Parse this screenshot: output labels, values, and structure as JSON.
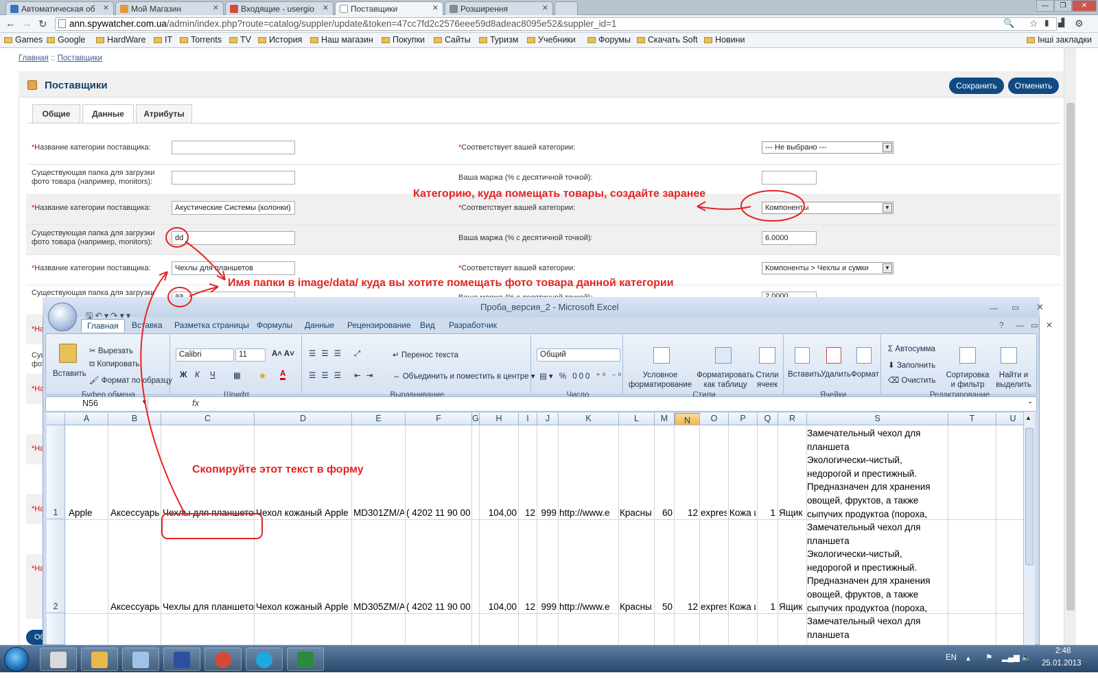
{
  "browser": {
    "tabs": [
      {
        "label": "Автоматическая об",
        "color": "#3b74c4"
      },
      {
        "label": "Мой Магазин",
        "color": "#e09a3a"
      },
      {
        "label": "Входящие - usergio",
        "color": "#d84a3a"
      },
      {
        "label": "Поставщики",
        "color": "#ffffff"
      },
      {
        "label": "Розширення",
        "color": "#8a8a8a"
      }
    ],
    "url_domain": "ann.spywatcher.com.ua",
    "url_path": "/admin/index.php?route=catalog/suppler/update&token=47cc7fd2c2576eee59d8adeac8095e52&suppler_id=1",
    "bookmarks": [
      "Games",
      "Google",
      "HardWare",
      "IT",
      "Torrents",
      "TV",
      "История",
      "Наш магазин",
      "Покупки",
      "Сайты",
      "Туризм",
      "Учебники",
      "Форумы",
      "Скачать Soft",
      "Новини"
    ],
    "other_bookmarks": "Інші закладки"
  },
  "page": {
    "breadcrumb_home": "Главная",
    "breadcrumb_sep": "::",
    "breadcrumb_current": "Поставщики",
    "title": "Поставщики",
    "save_label": "Сохранить",
    "cancel_label": "Отменить",
    "tabs": [
      "Общие",
      "Данные",
      "Атрибуты"
    ],
    "required_mark": "*",
    "rows": [
      {
        "label": "Название категории поставщика:",
        "value": "",
        "right_label": "Соответствует вашей категории:",
        "right_value": "--- Не выбрано ---",
        "required": true
      },
      {
        "label": "Существующая папка для загрузки фото товара (например, monitors):",
        "value": "",
        "right_label": "Ваша маржа (% с десятичной точкой):",
        "right_value": ""
      },
      {
        "label": "Название категории поставщика:",
        "value": "Акустические Системы (колонки)",
        "right_label": "Соответствует вашей категории:",
        "right_value": "Компоненты",
        "required": true
      },
      {
        "label": "Существующая папка для загрузки фото товара (например, monitors):",
        "value": "dd",
        "right_label": "Ваша маржа (% с десятичной точкой):",
        "right_value": "6.0000"
      },
      {
        "label": "Название категории поставщика:",
        "value": "Чехлы для планшетов",
        "right_label": "Соответствует вашей категории:",
        "right_value": "Компоненты > Чехлы и сумки",
        "required": true
      },
      {
        "label": "Существующая папка для загрузки фото товара (например, monitors):",
        "value": "aa",
        "right_label": "Ваша маржа (% с десятичной точкой):",
        "right_value": "2.0000"
      }
    ],
    "hidden_label_fragments": [
      "*На",
      "Сущ",
      "фот",
      "Об"
    ]
  },
  "annotations": {
    "category_note": "Категорию, куда помещать товары, создайте заранее",
    "folder_note": "Имя папки в image/data/ куда вы хотите помещать фото товара данной категории",
    "copy_note": "Скопируйте этот текст в форму",
    "color": "#e32424"
  },
  "excel": {
    "title": "Проба_версия_2 - Microsoft Excel",
    "ribbon_tabs": [
      "Главная",
      "Вставка",
      "Разметка страницы",
      "Формулы",
      "Данные",
      "Рецензирование",
      "Вид",
      "Разработчик"
    ],
    "clipboard": {
      "paste": "Вставить",
      "cut": "Вырезать",
      "copy": "Копировать",
      "format_painter": "Формат по образцу",
      "group": "Буфер обмена"
    },
    "font": {
      "name": "Calibri",
      "size": "11",
      "group": "Шрифт"
    },
    "alignment": {
      "wrap": "Перенос текста",
      "merge": "Объединить и поместить в центре",
      "group": "Выравнивание"
    },
    "number": {
      "format": "Общий",
      "group": "Число"
    },
    "styles": {
      "conditional": "Условное форматирование",
      "as_table": "Форматировать как таблицу",
      "cell_styles": "Стили ячеек",
      "group": "Стили"
    },
    "cells": {
      "insert": "Вставить",
      "delete": "Удалить",
      "format": "Формат",
      "group": "Ячейки"
    },
    "editing": {
      "autosum": "Автосумма",
      "fill": "Заполнить",
      "clear": "Очистить",
      "sort": "Сортировка и фильтр",
      "find": "Найти и выделить",
      "group": "Редактирование"
    },
    "name_box": "N56",
    "fx": "fx",
    "columns": [
      "A",
      "B",
      "C",
      "D",
      "E",
      "F",
      "G",
      "H",
      "I",
      "J",
      "K",
      "L",
      "M",
      "N",
      "O",
      "P",
      "Q",
      "R",
      "S",
      "T",
      "U"
    ],
    "selected_column": "N",
    "rows": [
      {
        "num": "1",
        "A": "Apple",
        "B": "Аксессуары",
        "C": "Чехлы для планшетов",
        "D": "Чехол кожаный Apple",
        "E": "MD301ZM/A",
        "F": "( 4202 11 90 00",
        "H": "104,00",
        "I": "12",
        "J": "999",
        "K": "http://www.e",
        "L": "Красны",
        "M": "60",
        "N": "12",
        "O": "expres",
        "P": "Кожа и",
        "Q": "1",
        "R": "Ящик с",
        "S": [
          "Замечательный чехол для",
          "планшета",
          "Экологически-чистый,",
          "недорогой и престижный.",
          "Предназначен для хранения",
          "овощей, фруктов, а также",
          "сыпучих продуктоа (пороха,"
        ]
      },
      {
        "num": "2",
        "A": "",
        "B": "Аксессуары",
        "C": "Чехлы для планшетов",
        "D": "Чехол кожаный Apple",
        "E": "MD305ZM/A",
        "F": "( 4202 11 90 00",
        "H": "104,00",
        "I": "12",
        "J": "999",
        "K": "http://www.e",
        "L": "Красны",
        "M": "50",
        "N": "12",
        "O": "expres",
        "P": "Кожа и",
        "Q": "1",
        "R": "Ящик с",
        "S": [
          "Замечательный чехол для",
          "планшета",
          "Экологически-чистый,",
          "недорогой и престижный.",
          "Предназначен для хранения",
          "овощей, фруктов, а также",
          "сыпучих продуктоа (пороха,"
        ]
      },
      {
        "num": "",
        "S": [
          "Замечательный чехол для",
          "планшета"
        ]
      }
    ]
  },
  "taskbar": {
    "lang": "EN",
    "time": "2:48",
    "date": "25.01.2013",
    "apps": [
      {
        "name": "calculator",
        "color": "#d9d9d9"
      },
      {
        "name": "explorer",
        "color": "#e6b94a"
      },
      {
        "name": "notepad",
        "color": "#9fc3e8"
      },
      {
        "name": "floppy",
        "color": "#2b4fa3"
      },
      {
        "name": "chrome",
        "color": "#d44a38"
      },
      {
        "name": "skype",
        "color": "#1fa7e0"
      },
      {
        "name": "excel",
        "color": "#2a8c3e"
      }
    ]
  }
}
